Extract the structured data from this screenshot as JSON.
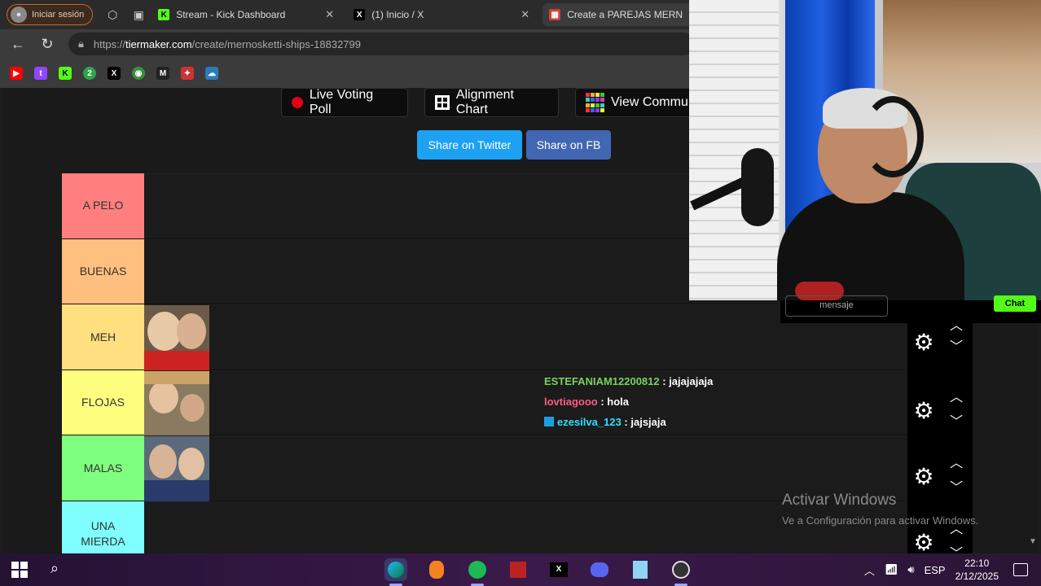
{
  "browser": {
    "profile_label": "Iniciar sesión",
    "tabs": [
      {
        "label": "Stream - Kick Dashboard",
        "close": "✕"
      },
      {
        "label": "(1) Inicio / X",
        "close": "✕"
      },
      {
        "label": "Create a PAREJAS MERN",
        "close": ""
      }
    ],
    "url_host": "tiermaker.com",
    "url_prefix": "https://",
    "url_path": "/create/mernosketti-ships-18832799"
  },
  "toolbar": {
    "live_voting_label": "Live Voting Poll",
    "alignment_chart_label": "Alignment Chart",
    "view_community_label": "View Commun"
  },
  "share": {
    "twitter_label": "Share on Twitter",
    "fb_label": "Share on FB",
    "twitter_color": "#1da1f2",
    "fb_color": "#4267b2"
  },
  "tiers": [
    {
      "label": "A PELO",
      "color": "#ff7f7f",
      "thumbs": 0
    },
    {
      "label": "BUENAS",
      "color": "#ffbf7f",
      "thumbs": 0
    },
    {
      "label": "MEH",
      "color": "#ffdf7f",
      "thumbs": 1
    },
    {
      "label": "FLOJAS",
      "color": "#ffff7f",
      "thumbs": 1
    },
    {
      "label": "MALAS",
      "color": "#7fff7f",
      "thumbs": 1
    },
    {
      "label": "UNA MIERDA",
      "color": "#7fffff",
      "thumbs": 0
    }
  ],
  "chat": [
    {
      "user": "ESTEFANIAM12200812",
      "message": ": jajajajaja"
    },
    {
      "user": "lovtiagooo",
      "message": ": hola"
    },
    {
      "user": "ezesilva_123",
      "message": ": jajsjaja"
    }
  ],
  "watermark": {
    "title": "Activar Windows",
    "subtitle": "Ve a Configuración para activar Windows."
  },
  "kick_overlay": {
    "input_label": "mensaje",
    "chat_button": "Chat"
  },
  "taskbar": {
    "language": "ESP",
    "time": "22:10",
    "date": "2/12/2025",
    "apps": [
      "edge-app",
      "fl-studio-app",
      "spotify-app",
      "media-app",
      "x-app",
      "discord-app",
      "notepad-app",
      "obs-app"
    ]
  }
}
